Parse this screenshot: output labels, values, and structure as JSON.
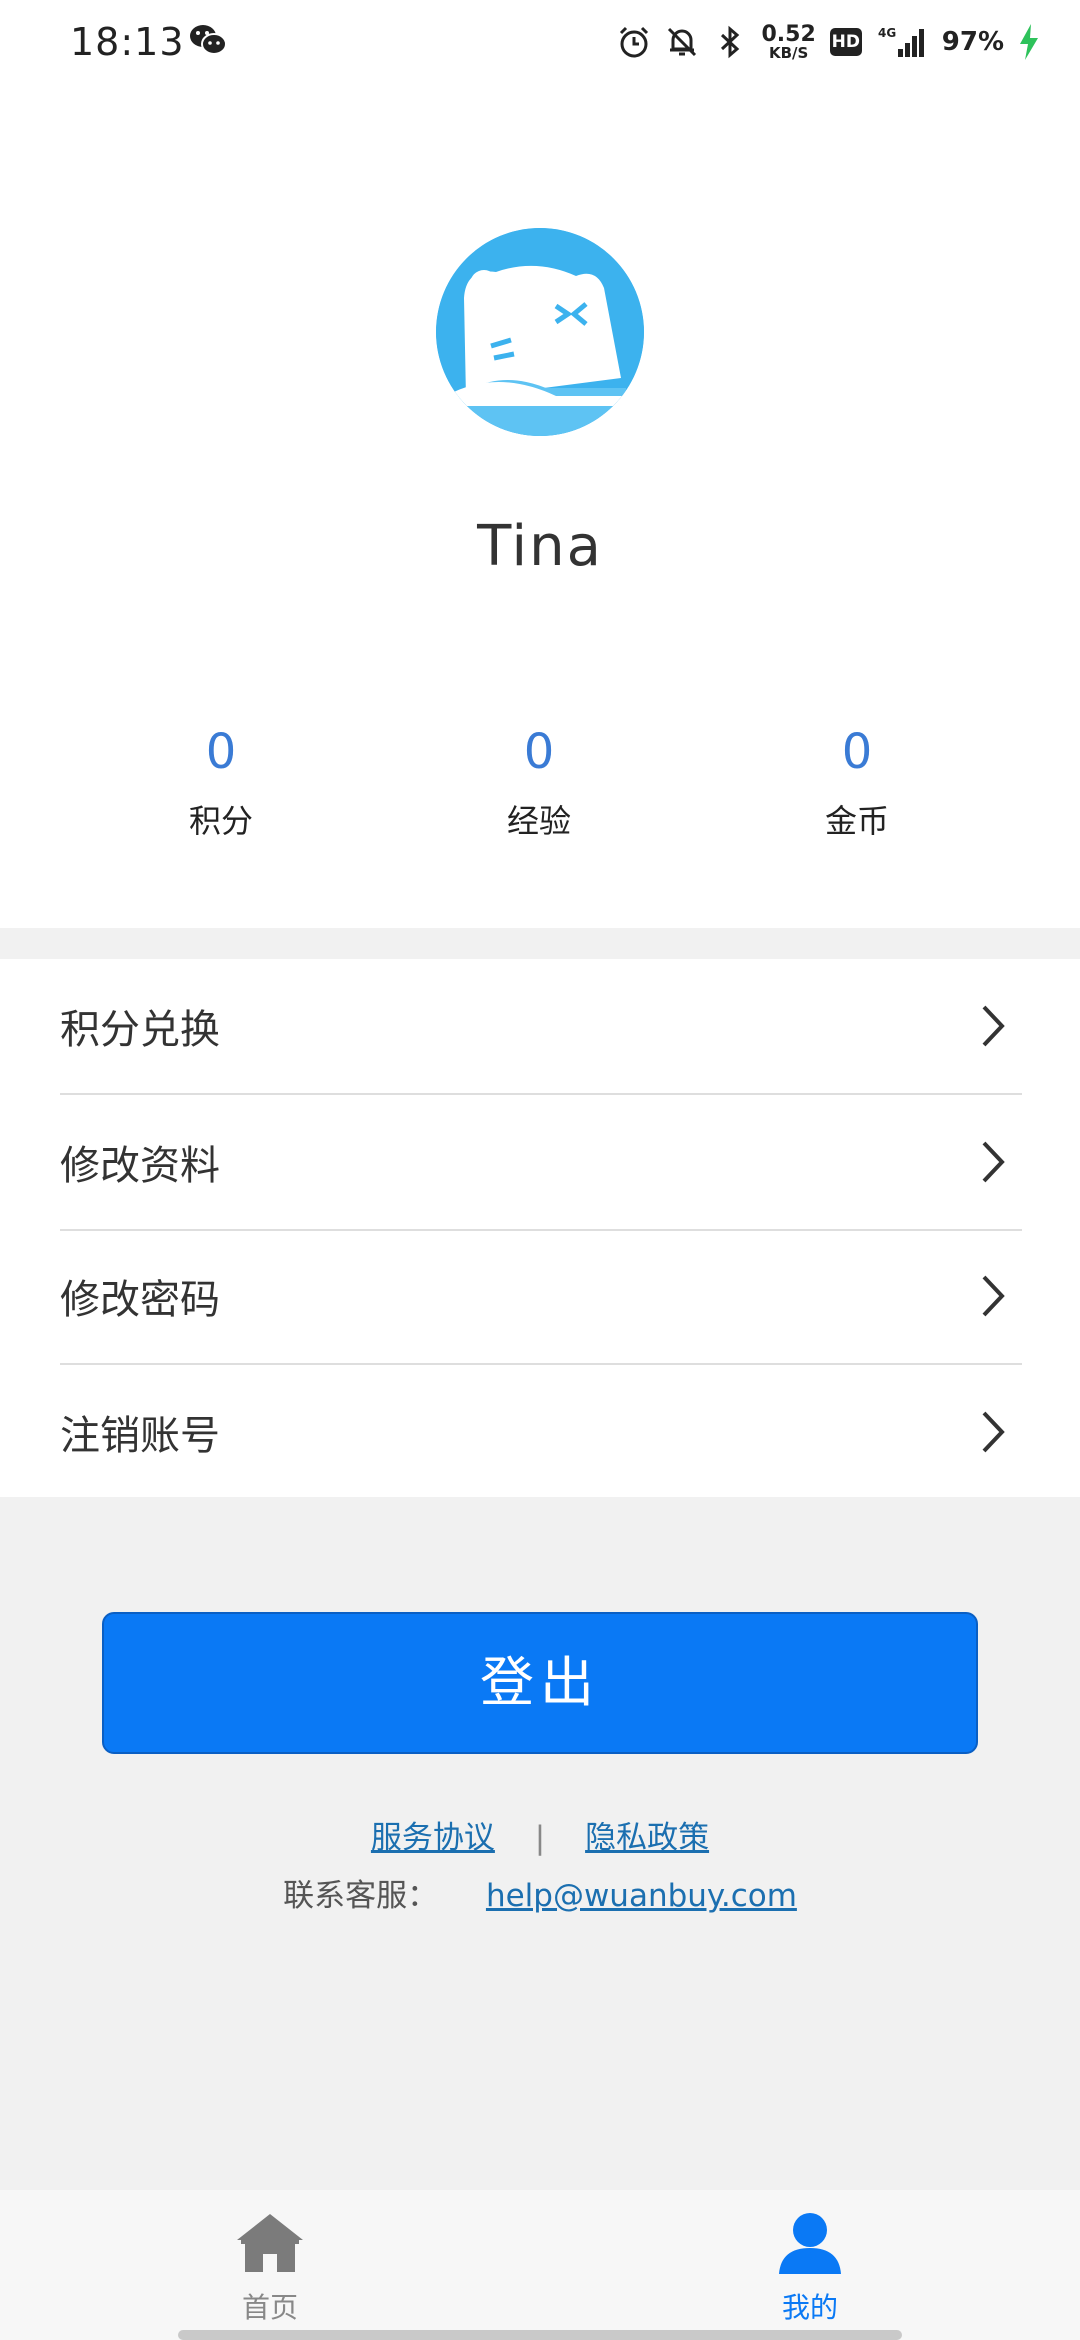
{
  "status_bar": {
    "time": "18:13",
    "net_speed": "0.52",
    "net_unit": "KB/S",
    "hd": "HD",
    "network": "4G",
    "battery": "97%"
  },
  "profile": {
    "username": "Tina",
    "stats": [
      {
        "value": "0",
        "label": "积分"
      },
      {
        "value": "0",
        "label": "经验"
      },
      {
        "value": "0",
        "label": "金币"
      }
    ]
  },
  "menu": [
    {
      "label": "积分兑换"
    },
    {
      "label": "修改资料"
    },
    {
      "label": "修改密码"
    },
    {
      "label": "注销账号"
    }
  ],
  "logout_label": "登出",
  "links": {
    "service": "服务协议",
    "separator": "|",
    "privacy": "隐私政策",
    "contact_label": "联系客服：",
    "contact_email": "help@wuanbuy.com"
  },
  "nav": {
    "home": "首页",
    "mine": "我的"
  },
  "colors": {
    "accent": "#0a79f5",
    "stat_value": "#3a7bd5",
    "link": "#1b6fb0",
    "nav_active": "#0a79f5",
    "nav_inactive": "#888888"
  }
}
